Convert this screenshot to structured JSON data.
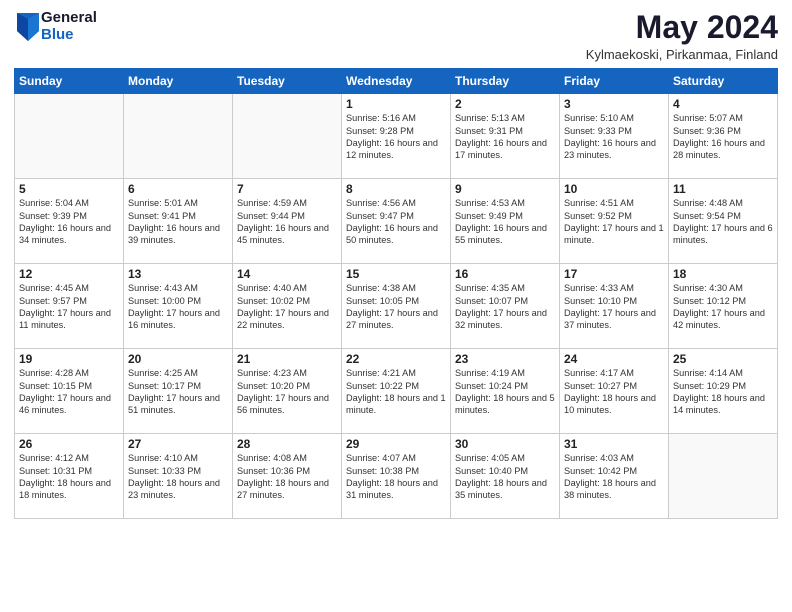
{
  "header": {
    "logo_general": "General",
    "logo_blue": "Blue",
    "title": "May 2024",
    "subtitle": "Kylmaekoski, Pirkanmaa, Finland"
  },
  "weekdays": [
    "Sunday",
    "Monday",
    "Tuesday",
    "Wednesday",
    "Thursday",
    "Friday",
    "Saturday"
  ],
  "weeks": [
    [
      {
        "day": "",
        "info": ""
      },
      {
        "day": "",
        "info": ""
      },
      {
        "day": "",
        "info": ""
      },
      {
        "day": "1",
        "info": "Sunrise: 5:16 AM\nSunset: 9:28 PM\nDaylight: 16 hours\nand 12 minutes."
      },
      {
        "day": "2",
        "info": "Sunrise: 5:13 AM\nSunset: 9:31 PM\nDaylight: 16 hours\nand 17 minutes."
      },
      {
        "day": "3",
        "info": "Sunrise: 5:10 AM\nSunset: 9:33 PM\nDaylight: 16 hours\nand 23 minutes."
      },
      {
        "day": "4",
        "info": "Sunrise: 5:07 AM\nSunset: 9:36 PM\nDaylight: 16 hours\nand 28 minutes."
      }
    ],
    [
      {
        "day": "5",
        "info": "Sunrise: 5:04 AM\nSunset: 9:39 PM\nDaylight: 16 hours\nand 34 minutes."
      },
      {
        "day": "6",
        "info": "Sunrise: 5:01 AM\nSunset: 9:41 PM\nDaylight: 16 hours\nand 39 minutes."
      },
      {
        "day": "7",
        "info": "Sunrise: 4:59 AM\nSunset: 9:44 PM\nDaylight: 16 hours\nand 45 minutes."
      },
      {
        "day": "8",
        "info": "Sunrise: 4:56 AM\nSunset: 9:47 PM\nDaylight: 16 hours\nand 50 minutes."
      },
      {
        "day": "9",
        "info": "Sunrise: 4:53 AM\nSunset: 9:49 PM\nDaylight: 16 hours\nand 55 minutes."
      },
      {
        "day": "10",
        "info": "Sunrise: 4:51 AM\nSunset: 9:52 PM\nDaylight: 17 hours\nand 1 minute."
      },
      {
        "day": "11",
        "info": "Sunrise: 4:48 AM\nSunset: 9:54 PM\nDaylight: 17 hours\nand 6 minutes."
      }
    ],
    [
      {
        "day": "12",
        "info": "Sunrise: 4:45 AM\nSunset: 9:57 PM\nDaylight: 17 hours\nand 11 minutes."
      },
      {
        "day": "13",
        "info": "Sunrise: 4:43 AM\nSunset: 10:00 PM\nDaylight: 17 hours\nand 16 minutes."
      },
      {
        "day": "14",
        "info": "Sunrise: 4:40 AM\nSunset: 10:02 PM\nDaylight: 17 hours\nand 22 minutes."
      },
      {
        "day": "15",
        "info": "Sunrise: 4:38 AM\nSunset: 10:05 PM\nDaylight: 17 hours\nand 27 minutes."
      },
      {
        "day": "16",
        "info": "Sunrise: 4:35 AM\nSunset: 10:07 PM\nDaylight: 17 hours\nand 32 minutes."
      },
      {
        "day": "17",
        "info": "Sunrise: 4:33 AM\nSunset: 10:10 PM\nDaylight: 17 hours\nand 37 minutes."
      },
      {
        "day": "18",
        "info": "Sunrise: 4:30 AM\nSunset: 10:12 PM\nDaylight: 17 hours\nand 42 minutes."
      }
    ],
    [
      {
        "day": "19",
        "info": "Sunrise: 4:28 AM\nSunset: 10:15 PM\nDaylight: 17 hours\nand 46 minutes."
      },
      {
        "day": "20",
        "info": "Sunrise: 4:25 AM\nSunset: 10:17 PM\nDaylight: 17 hours\nand 51 minutes."
      },
      {
        "day": "21",
        "info": "Sunrise: 4:23 AM\nSunset: 10:20 PM\nDaylight: 17 hours\nand 56 minutes."
      },
      {
        "day": "22",
        "info": "Sunrise: 4:21 AM\nSunset: 10:22 PM\nDaylight: 18 hours\nand 1 minute."
      },
      {
        "day": "23",
        "info": "Sunrise: 4:19 AM\nSunset: 10:24 PM\nDaylight: 18 hours\nand 5 minutes."
      },
      {
        "day": "24",
        "info": "Sunrise: 4:17 AM\nSunset: 10:27 PM\nDaylight: 18 hours\nand 10 minutes."
      },
      {
        "day": "25",
        "info": "Sunrise: 4:14 AM\nSunset: 10:29 PM\nDaylight: 18 hours\nand 14 minutes."
      }
    ],
    [
      {
        "day": "26",
        "info": "Sunrise: 4:12 AM\nSunset: 10:31 PM\nDaylight: 18 hours\nand 18 minutes."
      },
      {
        "day": "27",
        "info": "Sunrise: 4:10 AM\nSunset: 10:33 PM\nDaylight: 18 hours\nand 23 minutes."
      },
      {
        "day": "28",
        "info": "Sunrise: 4:08 AM\nSunset: 10:36 PM\nDaylight: 18 hours\nand 27 minutes."
      },
      {
        "day": "29",
        "info": "Sunrise: 4:07 AM\nSunset: 10:38 PM\nDaylight: 18 hours\nand 31 minutes."
      },
      {
        "day": "30",
        "info": "Sunrise: 4:05 AM\nSunset: 10:40 PM\nDaylight: 18 hours\nand 35 minutes."
      },
      {
        "day": "31",
        "info": "Sunrise: 4:03 AM\nSunset: 10:42 PM\nDaylight: 18 hours\nand 38 minutes."
      },
      {
        "day": "",
        "info": ""
      }
    ]
  ]
}
